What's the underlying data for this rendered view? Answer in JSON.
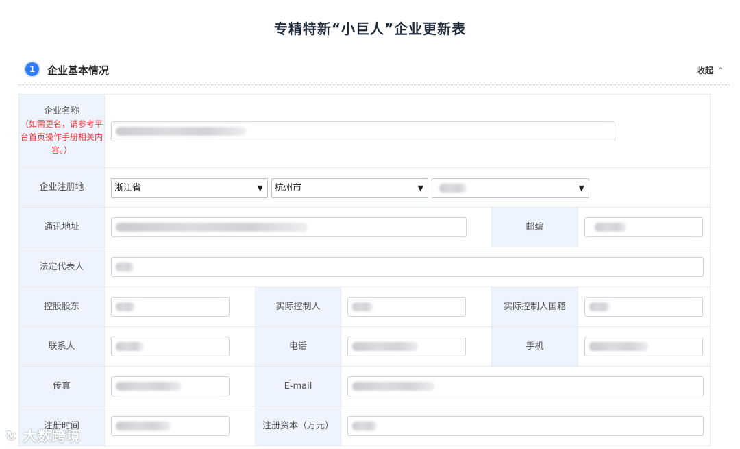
{
  "page": {
    "title": "专精特新“小巨人”企业更新表"
  },
  "section": {
    "number": "1",
    "title": "企业基本情况",
    "collapse_label": "收起",
    "collapse_icon": "chevron-double-up-icon"
  },
  "fields": {
    "company_name": {
      "label": "企业名称",
      "note": "（如需更名，请参考平台首页操作手册相关内容。）"
    },
    "registered_place": {
      "label": "企业注册地",
      "province": "浙江省",
      "city": "杭州市",
      "district": ""
    },
    "address": {
      "label": "通讯地址"
    },
    "postcode": {
      "label": "邮编"
    },
    "legal_rep": {
      "label": "法定代表人"
    },
    "controlling_shareholder": {
      "label": "控股股东"
    },
    "actual_controller": {
      "label": "实际控制人"
    },
    "controller_nationality": {
      "label": "实际控制人国籍"
    },
    "contact": {
      "label": "联系人"
    },
    "phone": {
      "label": "电话"
    },
    "mobile": {
      "label": "手机"
    },
    "fax": {
      "label": "传真"
    },
    "email": {
      "label": "E-mail"
    },
    "registration_time": {
      "label": "注册时间"
    },
    "registered_capital": {
      "label": "注册资本（万元）"
    }
  },
  "watermark": "大数跨境"
}
